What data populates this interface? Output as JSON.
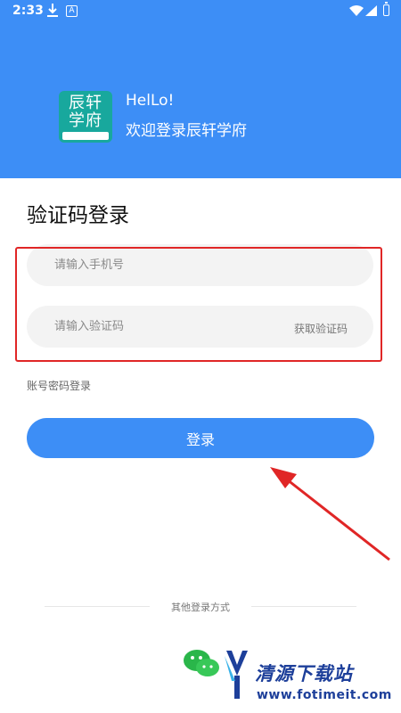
{
  "status_bar": {
    "time": "2:33",
    "a_badge": "A",
    "icons": [
      "download-icon",
      "a-icon",
      "wifi-icon",
      "signal-icon",
      "battery-icon"
    ]
  },
  "header": {
    "background_color": "#3d8ef6",
    "logo_text": "辰轩\n学府",
    "greeting": "HelLo!",
    "welcome": "欢迎登录辰轩学府"
  },
  "login": {
    "title": "验证码登录",
    "phone_placeholder": "请输入手机号",
    "code_placeholder": "请输入验证码",
    "get_code_label": "获取验证码",
    "password_login_link": "账号密码登录",
    "login_button": "登录"
  },
  "other_login": {
    "label": "其他登录方式",
    "icons": [
      "wechat-icon"
    ]
  },
  "watermark": {
    "text": "清源下载站",
    "url": "www.fotimeit.com"
  },
  "colors": {
    "accent": "#3d8ef6",
    "highlight_border": "#e02626",
    "field_background": "#f3f3f3"
  }
}
